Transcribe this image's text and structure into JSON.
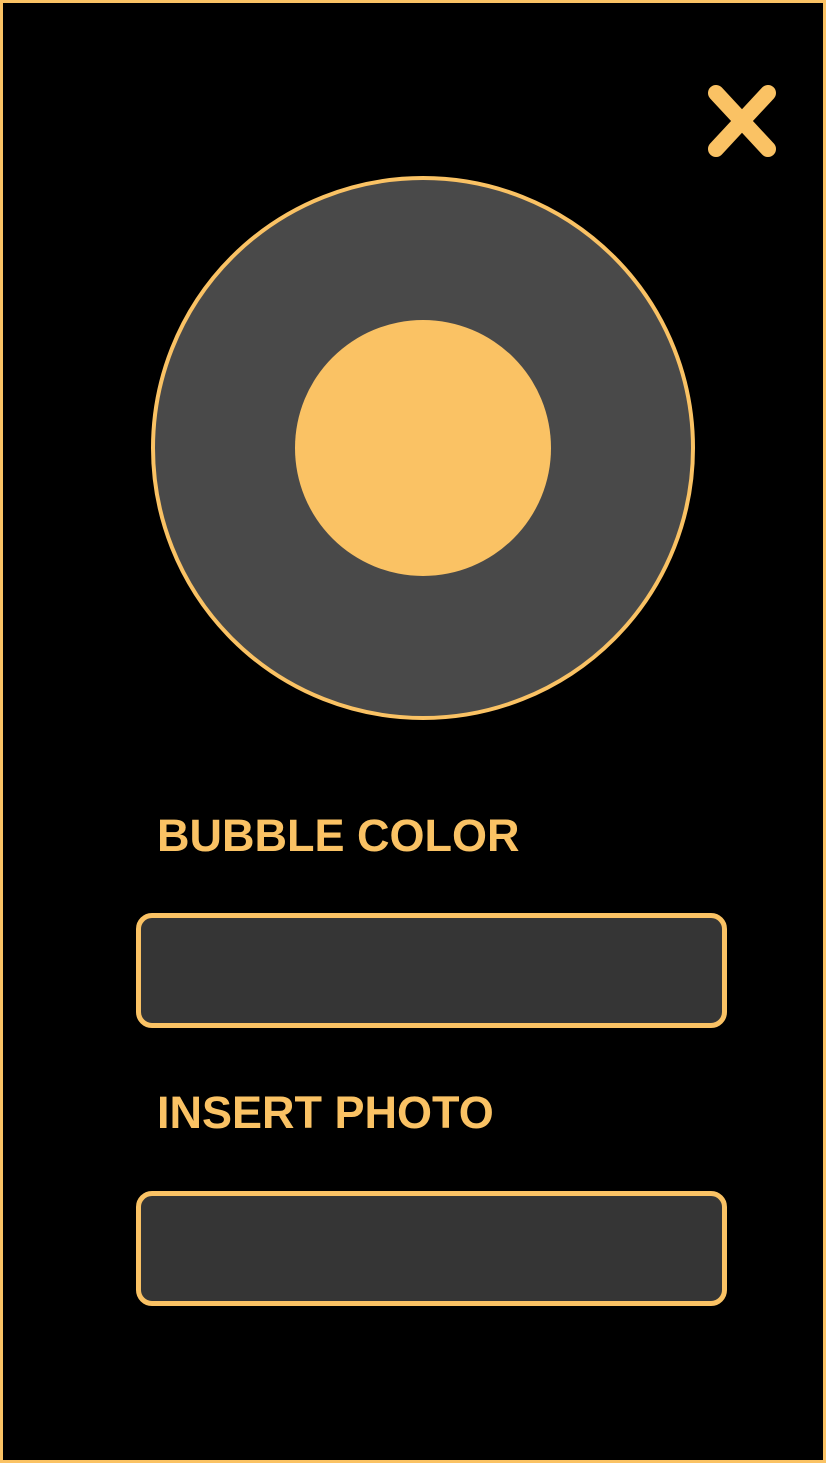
{
  "colors": {
    "background": "#000000",
    "accent": "#fac264",
    "bubble_fill": "#494949",
    "field_fill": "#353535"
  },
  "header": {
    "close_icon": "close-icon"
  },
  "preview": {
    "outer_icon": "bubble-preview-outer",
    "inner_icon": "bubble-preview-inner"
  },
  "form": {
    "bubble_color_label": "BUBBLE COLOR",
    "bubble_color_value": "",
    "insert_photo_label": "INSERT PHOTO",
    "insert_photo_value": ""
  }
}
